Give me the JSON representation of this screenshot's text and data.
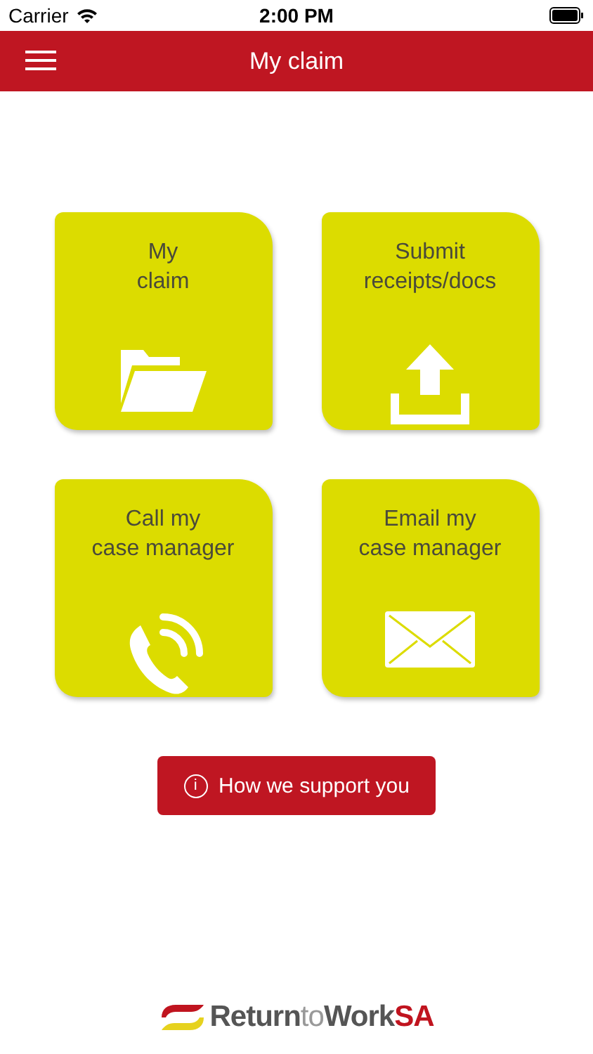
{
  "status_bar": {
    "carrier": "Carrier",
    "time": "2:00 PM"
  },
  "header": {
    "title": "My claim"
  },
  "tiles": [
    {
      "label": "My\nclaim",
      "kind": "folder"
    },
    {
      "label": "Submit\nreceipts/docs",
      "kind": "upload"
    },
    {
      "label": "Call my\ncase manager",
      "kind": "phone"
    },
    {
      "label": "Email my\ncase manager",
      "kind": "mail"
    }
  ],
  "support_button": {
    "label": "How we support you",
    "icon": "i"
  },
  "logo": [
    {
      "text": "Return",
      "kind": "dark"
    },
    {
      "text": "to",
      "kind": "light"
    },
    {
      "text": "Work",
      "kind": "dark"
    },
    {
      "text": "SA",
      "kind": "red"
    }
  ]
}
